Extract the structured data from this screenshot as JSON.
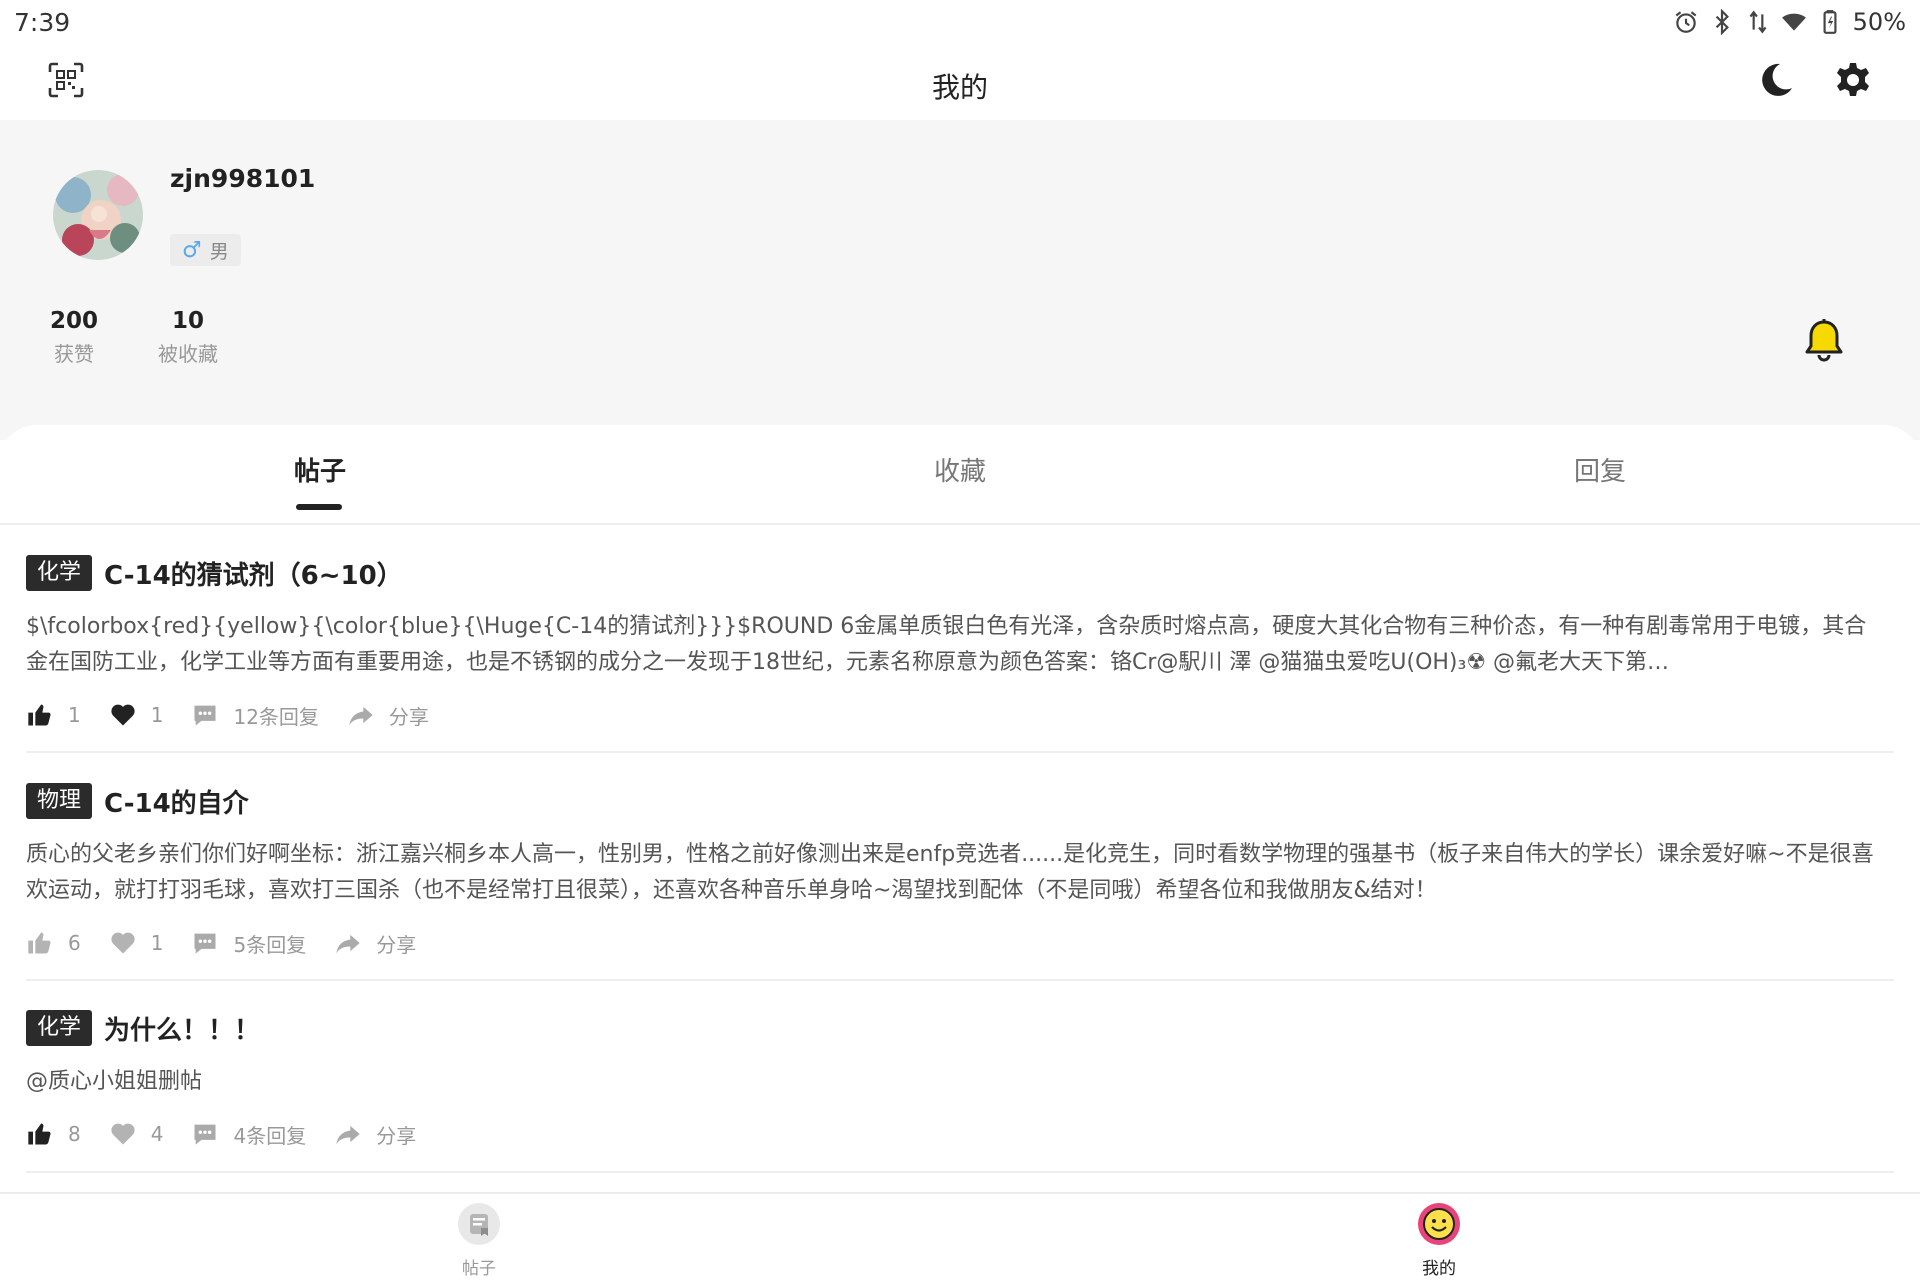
{
  "status_bar": {
    "time": "7:39",
    "battery": "50%"
  },
  "header": {
    "title": "我的",
    "icons": [
      "qr-scan-icon",
      "moon-icon",
      "gear-icon"
    ]
  },
  "profile": {
    "username": "zjn998101",
    "gender": "男",
    "stats": [
      {
        "value": "200",
        "label": "获赞"
      },
      {
        "value": "10",
        "label": "被收藏"
      }
    ]
  },
  "tabs": [
    {
      "label": "帖子",
      "active": true
    },
    {
      "label": "收藏",
      "active": false
    },
    {
      "label": "回复",
      "active": false
    }
  ],
  "posts": [
    {
      "tag": "化学",
      "title": "C-14的猜试剂（6~10）",
      "body": "$\\fcolorbox{red}{yellow}{\\color{blue}{\\Huge{C-14的猜试剂}}}$ROUND 6金属单质银白色有光泽，含杂质时熔点高，硬度大其化合物有三种价态，有一种有剧毒常用于电镀，其合金在国防工业，化学工业等方面有重要用途，也是不锈钢的成分之一发现于18世纪，元素名称原意为颜色答案：铬Cr@駅川 澤 @猫猫虫爱吃U(OH)₃☢ @氟老大天下第…",
      "likes": "1",
      "hearts": "1",
      "replies": "12条回复",
      "share": "分享",
      "liked": true,
      "hearted": true
    },
    {
      "tag": "物理",
      "title": "C-14的自介",
      "body": "质心的父老乡亲们你们好啊坐标：浙江嘉兴桐乡本人高一，性别男，性格之前好像测出来是enfp竞选者......是化竞生，同时看数学物理的强基书（板子来自伟大的学长）课余爱好嘛~不是很喜欢运动，就打打羽毛球，喜欢打三国杀（也不是经常打且很菜），还喜欢各种音乐单身哈~渴望找到配体（不是同哦）希望各位和我做朋友&结对！",
      "likes": "6",
      "hearts": "1",
      "replies": "5条回复",
      "share": "分享",
      "liked": false,
      "hearted": false
    },
    {
      "tag": "化学",
      "title": "为什么！！！",
      "body": "@质心小姐姐删帖",
      "likes": "8",
      "hearts": "4",
      "replies": "4条回复",
      "share": "分享",
      "liked": true,
      "hearted": false
    }
  ],
  "bottom_nav": [
    {
      "label": "帖子",
      "icon": "posts-icon",
      "active": false
    },
    {
      "label": "我的",
      "icon": "smiley-icon",
      "active": true
    }
  ],
  "colors": {
    "bell": "#f5d900",
    "tag_bg": "#2b2b2b",
    "gender_icon": "#5aa7ef",
    "active_nav": "#e8447a"
  }
}
